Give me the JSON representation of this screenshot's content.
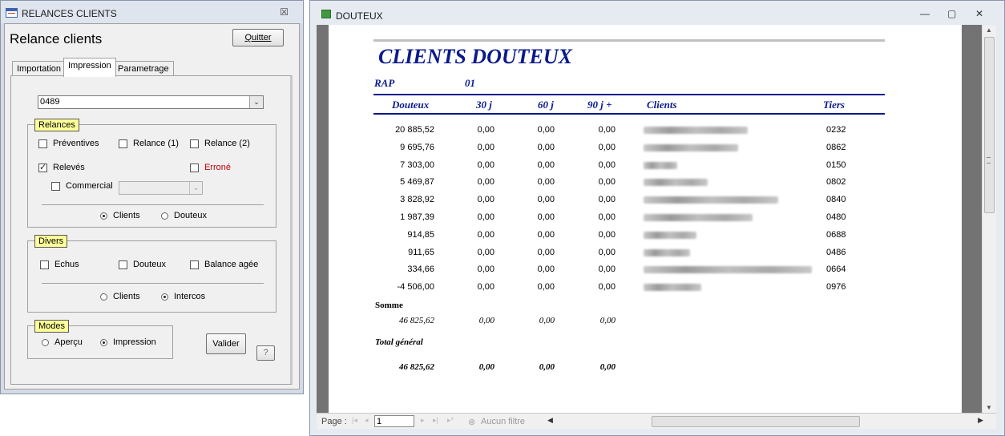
{
  "left_window": {
    "title": "RELANCES CLIENTS",
    "close_glyph": "☒",
    "form_title": "Relance clients",
    "quit_label": "Quitter",
    "tabs": [
      {
        "label": "Importation"
      },
      {
        "label": "Impression"
      },
      {
        "label": "Parametrage"
      }
    ],
    "combo_value": "0489",
    "combo_arrow": "⌄",
    "relances": {
      "label": "Relances",
      "preventives": "Préventives",
      "relance1": "Relance (1)",
      "relance2": "Relance (2)",
      "releves": "Relevés",
      "errone": "Erroné",
      "commercial": "Commercial",
      "radio_clients": "Clients",
      "radio_douteux": "Douteux"
    },
    "divers": {
      "label": "Divers",
      "echus": "Echus",
      "douteux": "Douteux",
      "balance": "Balance agée",
      "radio_clients": "Clients",
      "radio_intercos": "Intercos"
    },
    "modes": {
      "label": "Modes",
      "apercu": "Aperçu",
      "impression": "Impression"
    },
    "valider_label": "Valider",
    "help_label": "?"
  },
  "right_window": {
    "title": "DOUTEUX",
    "min_glyph": "—",
    "max_glyph": "▢",
    "close_glyph": "✕",
    "report": {
      "title": "CLIENTS DOUTEUX",
      "rap_label": "RAP",
      "rap_value": "01",
      "columns": [
        "Douteux",
        "30 j",
        "60 j",
        "90 j +",
        "Clients",
        "Tiers"
      ],
      "rows": [
        {
          "douteux": "20 885,52",
          "j30": "0,00",
          "j60": "0,00",
          "j90": "0,00",
          "tiers": "0232"
        },
        {
          "douteux": "9 695,76",
          "j30": "0,00",
          "j60": "0,00",
          "j90": "0,00",
          "tiers": "0862"
        },
        {
          "douteux": "7 303,00",
          "j30": "0,00",
          "j60": "0,00",
          "j90": "0,00",
          "tiers": "0150"
        },
        {
          "douteux": "5 469,87",
          "j30": "0,00",
          "j60": "0,00",
          "j90": "0,00",
          "tiers": "0802"
        },
        {
          "douteux": "3 828,92",
          "j30": "0,00",
          "j60": "0,00",
          "j90": "0,00",
          "tiers": "0840"
        },
        {
          "douteux": "1 987,39",
          "j30": "0,00",
          "j60": "0,00",
          "j90": "0,00",
          "tiers": "0480"
        },
        {
          "douteux": "914,85",
          "j30": "0,00",
          "j60": "0,00",
          "j90": "0,00",
          "tiers": "0688"
        },
        {
          "douteux": "911,65",
          "j30": "0,00",
          "j60": "0,00",
          "j90": "0,00",
          "tiers": "0486"
        },
        {
          "douteux": "334,66",
          "j30": "0,00",
          "j60": "0,00",
          "j90": "0,00",
          "tiers": "0664"
        },
        {
          "douteux": "-4 506,00",
          "j30": "0,00",
          "j60": "0,00",
          "j90": "0,00",
          "tiers": "0976"
        }
      ],
      "somme_label": "Somme",
      "somme": {
        "douteux": "46 825,62",
        "j30": "0,00",
        "j60": "0,00",
        "j90": "0,00"
      },
      "total_label": "Total général",
      "total": {
        "douteux": "46 825,62",
        "j30": "0,00",
        "j60": "0,00",
        "j90": "0,00"
      }
    },
    "navbar": {
      "page_label": "Page :",
      "page_value": "1",
      "first": "|◂",
      "prev": "◂",
      "next": "▸",
      "last": "▸|",
      "new": "▸*",
      "filter_label": "Aucun filtre",
      "filter_icon": "⊗"
    }
  }
}
